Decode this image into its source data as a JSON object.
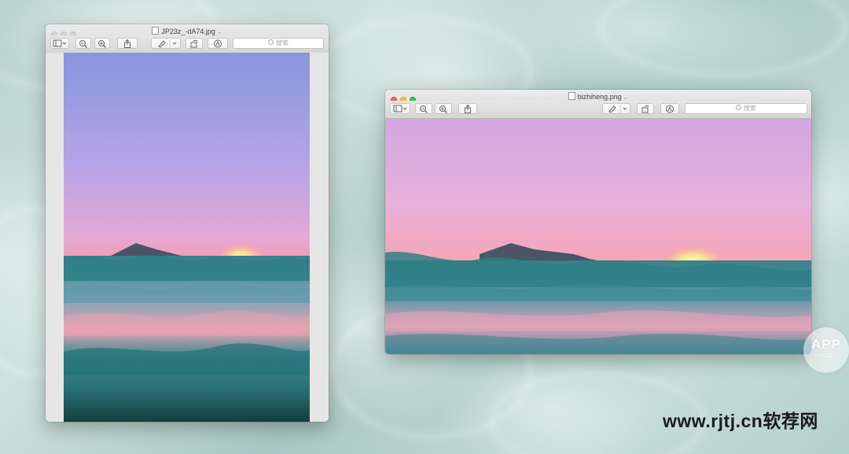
{
  "window_left": {
    "filename": "JP23z_-dA74.jpg",
    "search_placeholder": "搜索"
  },
  "window_right": {
    "filename": "bizhiheng.png",
    "search_placeholder": "搜索"
  },
  "watermark": {
    "badge_line1": "APP",
    "badge_line2": "solution",
    "site": "www.rjtj.cn软荐网"
  },
  "icons": [
    "sidebar-icon",
    "zoom-out-icon",
    "zoom-in-icon",
    "share-icon",
    "markup-pen-icon",
    "rotate-icon",
    "annotate-icon",
    "search-icon",
    "document-icon"
  ],
  "colors": {
    "sky_top": "#8a9ee0",
    "sky_mid": "#d8a9e0",
    "horizon": "#f59aa6",
    "sea": "#2e7f85",
    "close": "#fc5f57",
    "minimize": "#fdbc2e",
    "zoom": "#27c840"
  }
}
